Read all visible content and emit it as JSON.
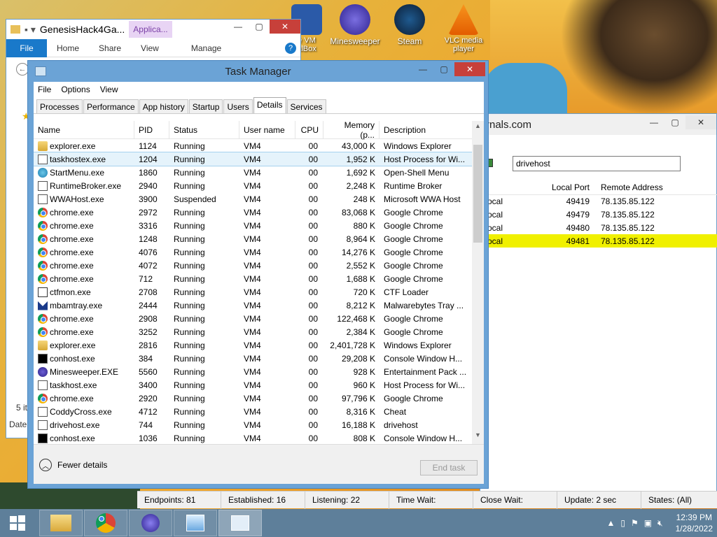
{
  "desktop_icons": [
    {
      "label": "e VM\nalBox"
    },
    {
      "label": "Minesweeper"
    },
    {
      "label": "Steam"
    },
    {
      "label": "VLC media player"
    }
  ],
  "explorer": {
    "title": "GenesisHack4Ga...",
    "app_tab": "Applica...",
    "ribbon": {
      "file": "File",
      "home": "Home",
      "share": "Share",
      "view": "View",
      "manage": "Manage"
    },
    "items_count": "5 it",
    "date_col": "Date"
  },
  "tcpview": {
    "title_partial": "rnals.com",
    "search_value": "drivehost",
    "columns": {
      "local_port": "Local Port",
      "remote_address": "Remote Address"
    },
    "rows": [
      {
        "proto": "ocal",
        "port": "49419",
        "remote": "78.135.85.122"
      },
      {
        "proto": "ocal",
        "port": "49479",
        "remote": "78.135.85.122"
      },
      {
        "proto": "ocal",
        "port": "49480",
        "remote": "78.135.85.122"
      },
      {
        "proto": "ocal",
        "port": "49481",
        "remote": "78.135.85.122"
      }
    ],
    "status": {
      "endpoints": "Endpoints: 81",
      "established": "Established: 16",
      "listening": "Listening: 22",
      "time_wait": "Time Wait:",
      "close_wait": "Close Wait:",
      "update": "Update: 2 sec",
      "states": "States: (All)"
    }
  },
  "task_manager": {
    "title": "Task Manager",
    "menu": {
      "file": "File",
      "options": "Options",
      "view": "View"
    },
    "tabs": [
      "Processes",
      "Performance",
      "App history",
      "Startup",
      "Users",
      "Details",
      "Services"
    ],
    "active_tab": "Details",
    "columns": {
      "name": "Name",
      "pid": "PID",
      "status": "Status",
      "user": "User name",
      "cpu": "CPU",
      "memory": "Memory (p...",
      "description": "Description"
    },
    "processes": [
      {
        "icon": "explorer-icon",
        "name": "explorer.exe",
        "pid": "1124",
        "status": "Running",
        "user": "VM4",
        "cpu": "00",
        "mem": "43,000 K",
        "desc": "Windows Explorer"
      },
      {
        "icon": "generic-app-icon",
        "name": "taskhostex.exe",
        "pid": "1204",
        "status": "Running",
        "user": "VM4",
        "cpu": "00",
        "mem": "1,952 K",
        "desc": "Host Process for Wi..."
      },
      {
        "icon": "startmenu-icon",
        "name": "StartMenu.exe",
        "pid": "1860",
        "status": "Running",
        "user": "VM4",
        "cpu": "00",
        "mem": "1,692 K",
        "desc": "Open-Shell Menu"
      },
      {
        "icon": "generic-app-icon",
        "name": "RuntimeBroker.exe",
        "pid": "2940",
        "status": "Running",
        "user": "VM4",
        "cpu": "00",
        "mem": "2,248 K",
        "desc": "Runtime Broker"
      },
      {
        "icon": "generic-app-icon",
        "name": "WWAHost.exe",
        "pid": "3900",
        "status": "Suspended",
        "user": "VM4",
        "cpu": "00",
        "mem": "248 K",
        "desc": "Microsoft WWA Host"
      },
      {
        "icon": "chrome-icon",
        "name": "chrome.exe",
        "pid": "2972",
        "status": "Running",
        "user": "VM4",
        "cpu": "00",
        "mem": "83,068 K",
        "desc": "Google Chrome"
      },
      {
        "icon": "chrome-icon",
        "name": "chrome.exe",
        "pid": "3316",
        "status": "Running",
        "user": "VM4",
        "cpu": "00",
        "mem": "880 K",
        "desc": "Google Chrome"
      },
      {
        "icon": "chrome-icon",
        "name": "chrome.exe",
        "pid": "1248",
        "status": "Running",
        "user": "VM4",
        "cpu": "00",
        "mem": "8,964 K",
        "desc": "Google Chrome"
      },
      {
        "icon": "chrome-icon",
        "name": "chrome.exe",
        "pid": "4076",
        "status": "Running",
        "user": "VM4",
        "cpu": "00",
        "mem": "14,276 K",
        "desc": "Google Chrome"
      },
      {
        "icon": "chrome-icon",
        "name": "chrome.exe",
        "pid": "4072",
        "status": "Running",
        "user": "VM4",
        "cpu": "00",
        "mem": "2,552 K",
        "desc": "Google Chrome"
      },
      {
        "icon": "chrome-icon",
        "name": "chrome.exe",
        "pid": "712",
        "status": "Running",
        "user": "VM4",
        "cpu": "00",
        "mem": "1,688 K",
        "desc": "Google Chrome"
      },
      {
        "icon": "ctf-icon",
        "name": "ctfmon.exe",
        "pid": "2708",
        "status": "Running",
        "user": "VM4",
        "cpu": "00",
        "mem": "720 K",
        "desc": "CTF Loader"
      },
      {
        "icon": "malwarebytes-icon",
        "name": "mbamtray.exe",
        "pid": "2444",
        "status": "Running",
        "user": "VM4",
        "cpu": "00",
        "mem": "8,212 K",
        "desc": "Malwarebytes Tray ..."
      },
      {
        "icon": "chrome-icon",
        "name": "chrome.exe",
        "pid": "2908",
        "status": "Running",
        "user": "VM4",
        "cpu": "00",
        "mem": "122,468 K",
        "desc": "Google Chrome"
      },
      {
        "icon": "chrome-icon",
        "name": "chrome.exe",
        "pid": "3252",
        "status": "Running",
        "user": "VM4",
        "cpu": "00",
        "mem": "2,384 K",
        "desc": "Google Chrome"
      },
      {
        "icon": "explorer-icon",
        "name": "explorer.exe",
        "pid": "2816",
        "status": "Running",
        "user": "VM4",
        "cpu": "00",
        "mem": "2,401,728 K",
        "desc": "Windows Explorer"
      },
      {
        "icon": "console-icon",
        "name": "conhost.exe",
        "pid": "384",
        "status": "Running",
        "user": "VM4",
        "cpu": "00",
        "mem": "29,208 K",
        "desc": "Console Window H..."
      },
      {
        "icon": "minesweeper-icon",
        "name": "Minesweeper.EXE",
        "pid": "5560",
        "status": "Running",
        "user": "VM4",
        "cpu": "00",
        "mem": "928 K",
        "desc": "Entertainment Pack ..."
      },
      {
        "icon": "generic-app-icon",
        "name": "taskhost.exe",
        "pid": "3400",
        "status": "Running",
        "user": "VM4",
        "cpu": "00",
        "mem": "960 K",
        "desc": "Host Process for Wi..."
      },
      {
        "icon": "chrome-icon",
        "name": "chrome.exe",
        "pid": "2920",
        "status": "Running",
        "user": "VM4",
        "cpu": "00",
        "mem": "97,796 K",
        "desc": "Google Chrome"
      },
      {
        "icon": "generic-app-icon",
        "name": "CoddyCross.exe",
        "pid": "4712",
        "status": "Running",
        "user": "VM4",
        "cpu": "00",
        "mem": "8,316 K",
        "desc": "Cheat"
      },
      {
        "icon": "generic-app-icon",
        "name": "drivehost.exe",
        "pid": "744",
        "status": "Running",
        "user": "VM4",
        "cpu": "00",
        "mem": "16,188 K",
        "desc": "drivehost"
      },
      {
        "icon": "console-icon",
        "name": "conhost.exe",
        "pid": "1036",
        "status": "Running",
        "user": "VM4",
        "cpu": "00",
        "mem": "808 K",
        "desc": "Console Window H..."
      }
    ],
    "selected_row": 1,
    "fewer_details": "Fewer details",
    "end_task": "End task"
  },
  "taskbar": {
    "time": "12:39 PM",
    "date": "1/28/2022"
  }
}
